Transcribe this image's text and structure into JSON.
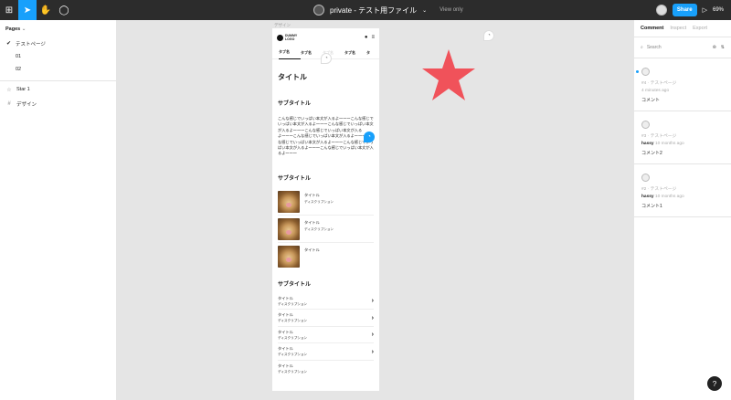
{
  "toolbar": {
    "file_title": "private - テスト用ファイル",
    "view_only": "View only",
    "share": "Share",
    "zoom": "69%"
  },
  "left_panel": {
    "pages_header": "Pages",
    "pages": [
      {
        "label": "テストページ",
        "selected": true
      },
      {
        "label": "01",
        "selected": false
      },
      {
        "label": "02",
        "selected": false
      }
    ],
    "layers": [
      {
        "label": "Star 1",
        "icon": "star-icon"
      },
      {
        "label": "デザイン",
        "icon": "frame-icon"
      }
    ]
  },
  "canvas": {
    "frame_label": "デザイン",
    "logo": "DUMMY LOGO",
    "tabs": [
      "タブ名",
      "タブ名",
      "タブ名",
      "タブ名",
      "タ"
    ],
    "title": "タイトル",
    "subtitle1": "サブタイトル",
    "body_text": "こんな感じでいっぱい本文が入るよ〜〜〜こんな感じでいっぱい本文が入るよ〜〜〜こんな感じでいっぱい本文が入るよ〜〜〜こんな感じでいっぱい本文が入るよ〜〜〜こんな感じでいっぱい本文が入るよ〜〜〜こんな感じでいっぱい本文が入るよ〜〜〜こんな感じでいっぱい本文が入るよ〜〜〜こんな感じでいっぱい本文が入るよ〜〜〜",
    "subtitle2": "サブタイトル",
    "cards": [
      {
        "title": "タイトル",
        "desc": "ディスクリプション"
      },
      {
        "title": "タイトル",
        "desc": "ディスクリプション"
      },
      {
        "title": "タイトル",
        "desc": ""
      }
    ],
    "subtitle3": "サブタイトル",
    "list": [
      {
        "title": "タイトル",
        "desc": "ディスクリプション"
      },
      {
        "title": "タイトル",
        "desc": "ディスクリプション"
      },
      {
        "title": "タイトル",
        "desc": "ディスクリプション"
      },
      {
        "title": "タイトル",
        "desc": "ディスクリプション"
      },
      {
        "title": "タイトル",
        "desc": "ディスクリプション"
      }
    ],
    "star_color": "#f0525a"
  },
  "right_panel": {
    "tabs": [
      "Comment",
      "Inspect",
      "Export"
    ],
    "search_placeholder": "Search",
    "comments": [
      {
        "meta": "#4 · テストページ",
        "author": "",
        "time": "4 minutes ago",
        "body": "コメント",
        "unread": true
      },
      {
        "meta": "#3 · テストページ",
        "author": "hassy",
        "time": "10 months ago",
        "body": "コメント2",
        "unread": false
      },
      {
        "meta": "#2 · テストページ",
        "author": "hassy",
        "time": "10 months ago",
        "body": "コメント1",
        "unread": false
      }
    ]
  },
  "help": "?"
}
